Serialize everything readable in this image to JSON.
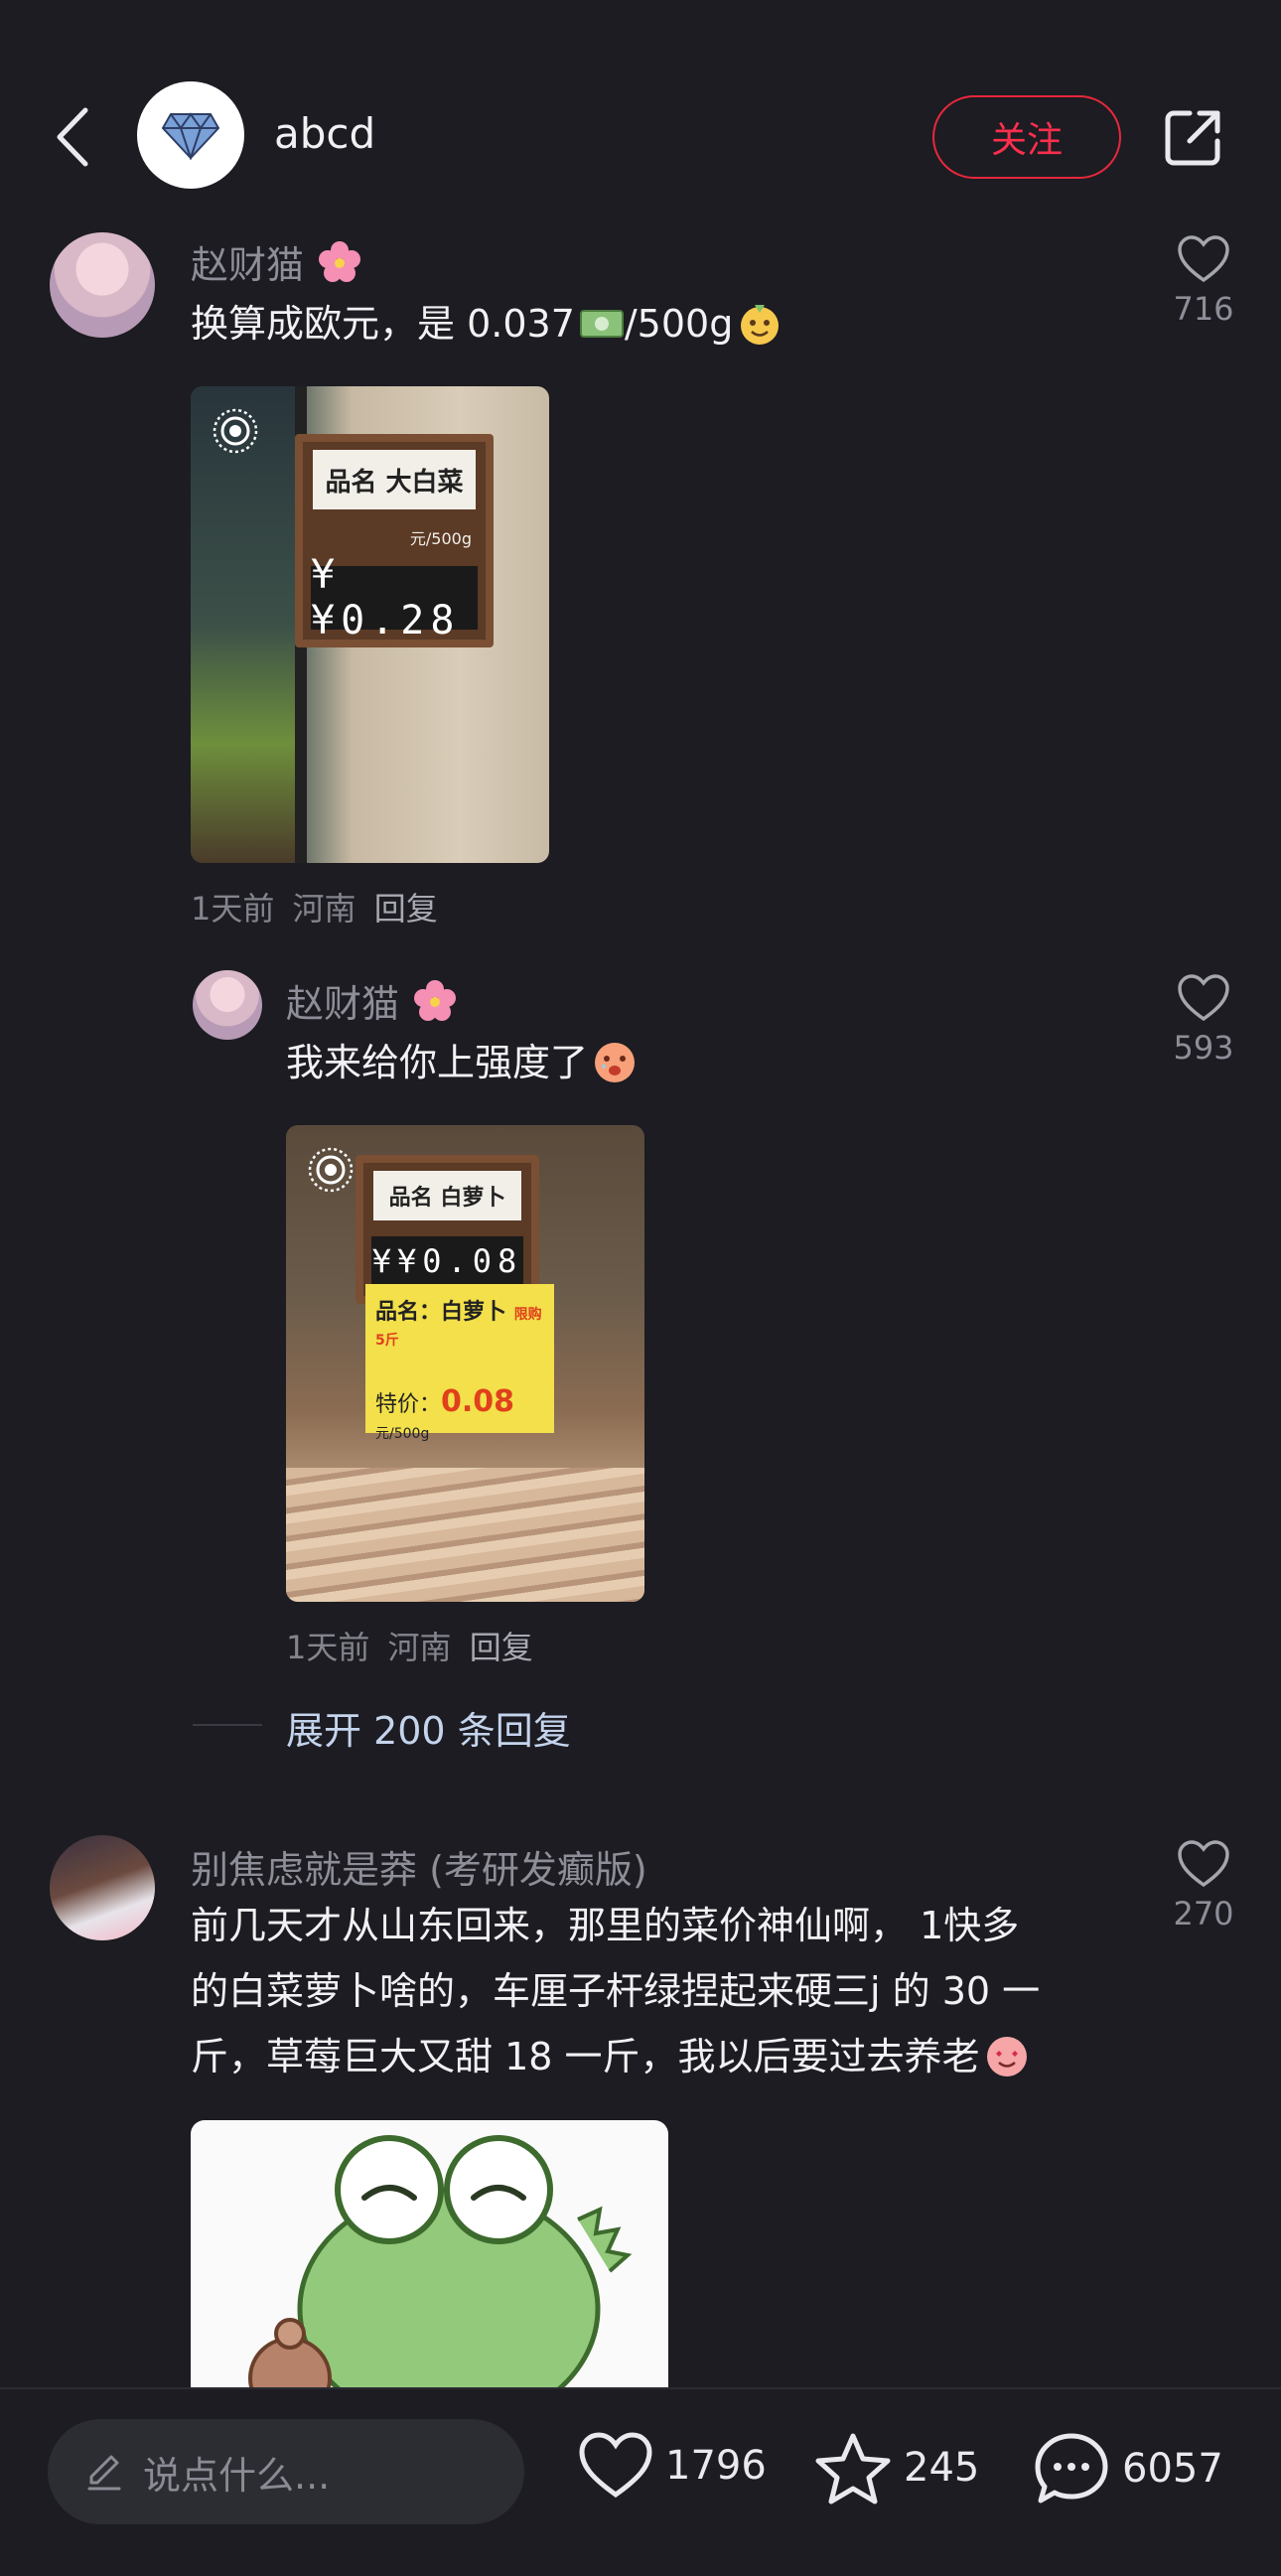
{
  "header": {
    "author_name": "abcd",
    "follow_label": "关注"
  },
  "comments": [
    {
      "username": "赵财猫",
      "text_before": "换算成欧元，是 0.037",
      "text_after": "/500g",
      "likes": "716",
      "image": {
        "board_title": "品名 大白菜",
        "board_price": "¥¥0.28",
        "board_unit": "元/500g"
      },
      "meta": {
        "time": "1天前",
        "location": "河南",
        "reply": "回复"
      },
      "replies": [
        {
          "username": "赵财猫",
          "text": "我来给你上强度了",
          "likes": "593",
          "image": {
            "board_title": "品名 白萝卜",
            "board_price": "¥¥0.08",
            "sign_line1": "品名：白萝卜",
            "sign_limit": "限购5斤",
            "sign_price_label": "特价：",
            "sign_price": "0.08",
            "sign_unit": "元/500g"
          },
          "meta": {
            "time": "1天前",
            "location": "河南",
            "reply": "回复"
          }
        }
      ],
      "expand_label": "展开 200 条回复"
    },
    {
      "username": "别焦虑就是莽 (考研发癫版)",
      "lines": [
        "前几天才从山东回来，那里的菜价神仙啊， 1快多",
        "的白菜萝卜啥的，车厘子杆绿捏起来硬三j 的 30 一",
        "斤，草莓巨大又甜 18 一斤，我以后要过去养老"
      ],
      "likes": "270"
    }
  ],
  "bottom_bar": {
    "input_placeholder": "说点什么...",
    "likes": "1796",
    "stars": "245",
    "comments": "6057"
  },
  "colors": {
    "background": "#1c1c22",
    "follow_red": "#ff2e4d",
    "expand_blue": "#c4d4ec"
  }
}
